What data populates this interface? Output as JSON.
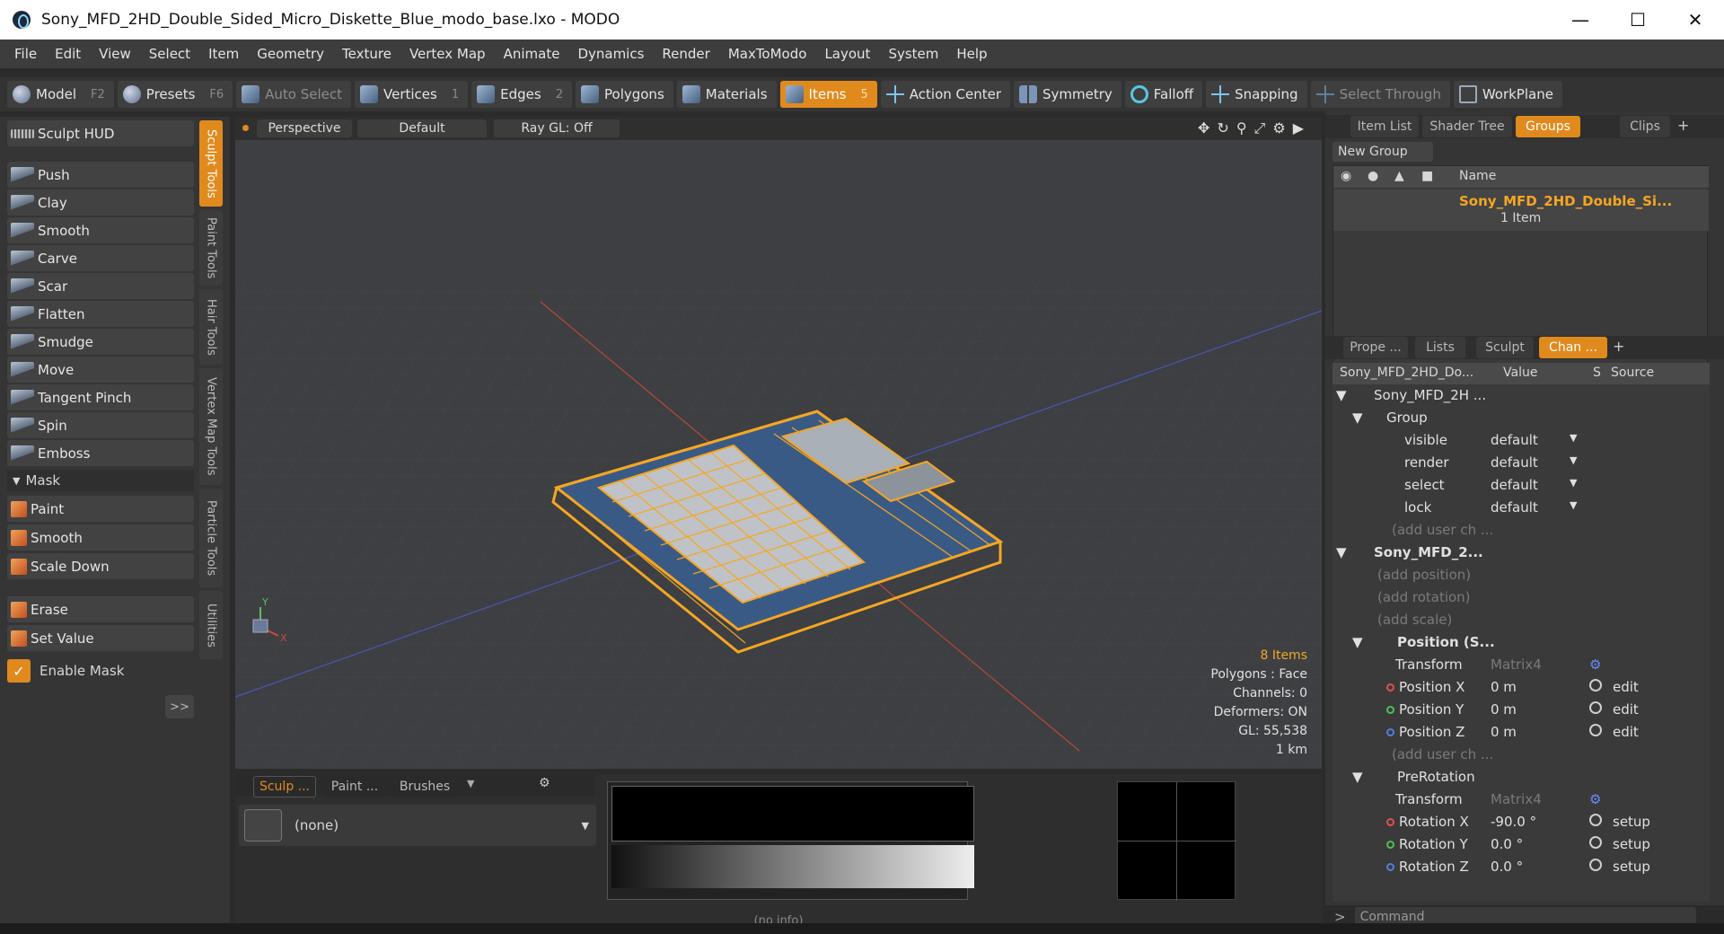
{
  "window": {
    "title": "Sony_MFD_2HD_Double_Sided_Micro_Diskette_Blue_modo_base.lxo - MODO"
  },
  "menu": [
    "File",
    "Edit",
    "View",
    "Select",
    "Item",
    "Geometry",
    "Texture",
    "Vertex Map",
    "Animate",
    "Dynamics",
    "Render",
    "MaxToModo",
    "Layout",
    "System",
    "Help"
  ],
  "toolbar": {
    "model": "Model",
    "model_key": "F2",
    "presets": "Presets",
    "presets_key": "F6",
    "auto_select": "Auto Select",
    "vertices": "Vertices",
    "vertices_key": "1",
    "edges": "Edges",
    "edges_key": "2",
    "polygons": "Polygons",
    "materials": "Materials",
    "items": "Items",
    "items_key": "5",
    "action_center": "Action Center",
    "symmetry": "Symmetry",
    "falloff": "Falloff",
    "snapping": "Snapping",
    "select_through": "Select Through",
    "workplane": "WorkPlane"
  },
  "sculpt": {
    "hud": "Sculpt HUD",
    "tools": [
      "Push",
      "Clay",
      "Smooth",
      "Carve",
      "Scar",
      "Flatten",
      "Smudge",
      "Move",
      "Tangent Pinch",
      "Spin",
      "Emboss"
    ],
    "mask_header": "Mask",
    "mask_tools": [
      "Paint",
      "Smooth",
      "Scale Down"
    ],
    "erase": "Erase",
    "set_value": "Set Value",
    "enable_mask": "Enable Mask",
    "more": ">>"
  },
  "vtabs": [
    "Sculpt Tools",
    "Paint Tools",
    "Hair Tools",
    "Vertex Map Tools",
    "Particle Tools",
    "Utilities"
  ],
  "viewport": {
    "view": "Perspective",
    "shading": "Default",
    "raygl": "Ray GL: Off",
    "stats": {
      "items": "8 Items",
      "polygons": "Polygons : Face",
      "channels": "Channels: 0",
      "deformers": "Deformers: ON",
      "gl": "GL: 55,538",
      "scale": "1 km"
    }
  },
  "bottom": {
    "tabs": [
      "Sculp ...",
      "Paint ...",
      "Brushes"
    ],
    "preset": "(none)",
    "info": "(no info)"
  },
  "groups_panel": {
    "tabs": [
      "Item List",
      "Shader Tree",
      "Groups",
      "Clips"
    ],
    "new_group": "New Group",
    "col_name": "Name",
    "item_name": "Sony_MFD_2HD_Double_Si...",
    "item_count": "1 Item"
  },
  "channels_panel": {
    "tabs": [
      "Prope ...",
      "Lists",
      "Sculpt",
      "Chan ..."
    ],
    "headers": {
      "name": "Sony_MFD_2HD_Do...",
      "value": "Value",
      "s": "S",
      "source": "Source"
    },
    "rows": [
      {
        "name": "Sony_MFD_2H ...",
        "value": "",
        "source": ""
      },
      {
        "name": "Group",
        "value": "",
        "source": ""
      },
      {
        "name": "visible",
        "value": "default",
        "source": ""
      },
      {
        "name": "render",
        "value": "default",
        "source": ""
      },
      {
        "name": "select",
        "value": "default",
        "source": ""
      },
      {
        "name": "lock",
        "value": "default",
        "source": ""
      },
      {
        "name": "(add user ch ...",
        "value": "",
        "source": ""
      },
      {
        "name": "Sony_MFD_2...",
        "value": "",
        "source": ""
      },
      {
        "name": "(add position)",
        "value": "",
        "source": ""
      },
      {
        "name": "(add rotation)",
        "value": "",
        "source": ""
      },
      {
        "name": "(add scale)",
        "value": "",
        "source": ""
      },
      {
        "name": "Position (S...",
        "value": "",
        "source": ""
      },
      {
        "name": "Transform",
        "value": "Matrix4",
        "source": ""
      },
      {
        "name": "Position X",
        "value": "0 m",
        "source": "edit"
      },
      {
        "name": "Position Y",
        "value": "0 m",
        "source": "edit"
      },
      {
        "name": "Position Z",
        "value": "0 m",
        "source": "edit"
      },
      {
        "name": "(add user ch ...",
        "value": "",
        "source": ""
      },
      {
        "name": "PreRotation",
        "value": "",
        "source": ""
      },
      {
        "name": "Transform",
        "value": "Matrix4",
        "source": ""
      },
      {
        "name": "Rotation X",
        "value": "-90.0 °",
        "source": "setup"
      },
      {
        "name": "Rotation Y",
        "value": "0.0 °",
        "source": "setup"
      },
      {
        "name": "Rotation Z",
        "value": "0.0 °",
        "source": "setup"
      }
    ]
  },
  "command": "Command",
  "colors": {
    "accent": "#e08a1e",
    "mesh": "#f5a623"
  }
}
